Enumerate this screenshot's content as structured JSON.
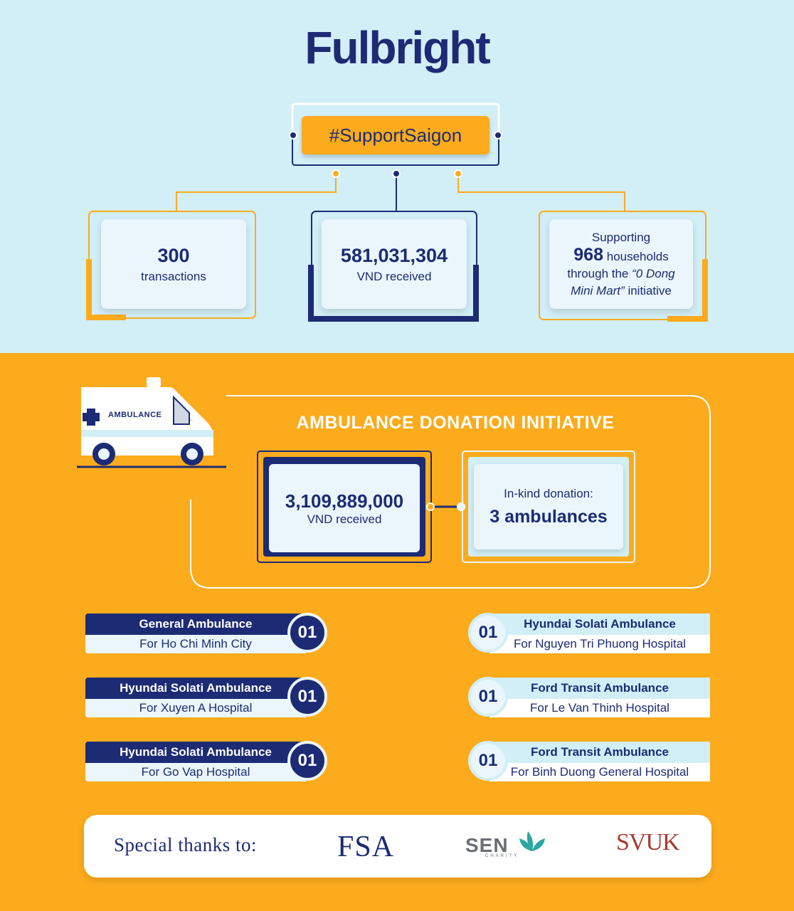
{
  "header": {
    "logo": "Fulbright",
    "hashtag": "#SupportSaigon"
  },
  "stats": {
    "transactions_value": "300",
    "transactions_label": "transactions",
    "received_value": "581,031,304",
    "received_label": "VND received",
    "households_pre": "Supporting",
    "households_value": "968",
    "households_post": "households",
    "households_line3_a": "through the",
    "households_line3_b": "“0 Dong",
    "households_line4_a": "Mini Mart”",
    "households_line4_b": "initiative"
  },
  "ambulance": {
    "van_label": "AMBULANCE",
    "title": "AMBULANCE DONATION INITIATIVE",
    "money_value": "3,109,889,000",
    "money_label": "VND received",
    "kind_label": "In-kind donation:",
    "kind_value": "3 ambulances"
  },
  "left_items": [
    {
      "title": "General Ambulance",
      "subtitle": "For Ho Chi Minh City",
      "count": "01"
    },
    {
      "title": "Hyundai Solati Ambulance",
      "subtitle": "For Xuyen A Hospital",
      "count": "01"
    },
    {
      "title": "Hyundai Solati Ambulance",
      "subtitle": "For Go Vap Hospital",
      "count": "01"
    }
  ],
  "right_items": [
    {
      "title": "Hyundai Solati Ambulance",
      "subtitle": "For Nguyen Tri Phuong Hospital",
      "count": "01"
    },
    {
      "title": "Ford Transit Ambulance",
      "subtitle": "For Le Van Thinh Hospital",
      "count": "01"
    },
    {
      "title": "Ford Transit Ambulance",
      "subtitle": "For Binh Duong General Hospital",
      "count": "01"
    }
  ],
  "thanks": {
    "label": "Special thanks to:",
    "sponsor_1": "FSA",
    "sponsor_2": "SEN",
    "sponsor_2_sub": "CHARITY",
    "sponsor_3": "SVUK"
  },
  "colors": {
    "navy": "#1c2b74",
    "gold": "#fbab1c",
    "light_blue": "#d2eef7"
  }
}
